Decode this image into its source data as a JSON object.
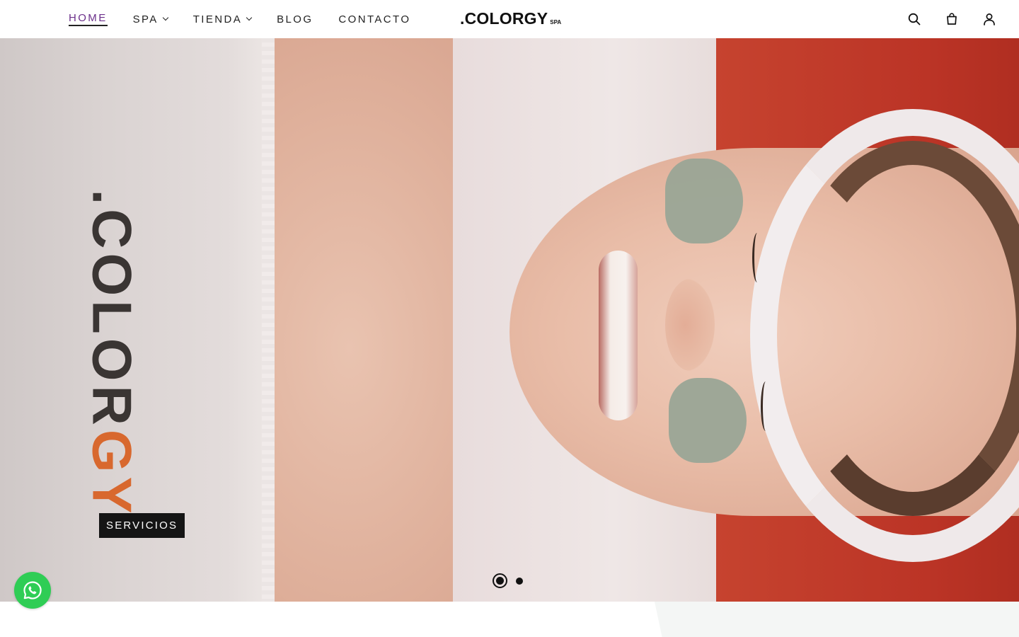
{
  "header": {
    "nav": [
      {
        "label": "HOME",
        "active": true,
        "dropdown": false
      },
      {
        "label": "SPA",
        "active": false,
        "dropdown": true
      },
      {
        "label": "TIENDA",
        "active": false,
        "dropdown": true
      },
      {
        "label": "BLOG",
        "active": false,
        "dropdown": false
      },
      {
        "label": "CONTACTO",
        "active": false,
        "dropdown": false
      }
    ],
    "logo": {
      "main": ".COLORGY",
      "sub": "SPA"
    },
    "icons": [
      "search-icon",
      "shopping-bag-icon",
      "user-icon"
    ]
  },
  "hero": {
    "towel_text_main": ".COLOR",
    "towel_text_accent": "GY",
    "bed_text": ".CO...Y",
    "cta_label": "SERVICIOS",
    "slides": {
      "total": 2,
      "active": 1
    }
  },
  "colors": {
    "nav_active": "#6b2f8a",
    "cta_bg": "#151515",
    "whatsapp": "#2fcd55",
    "brand_accent": "#d8682e"
  },
  "floating": {
    "whatsapp_icon": "whatsapp-icon"
  }
}
